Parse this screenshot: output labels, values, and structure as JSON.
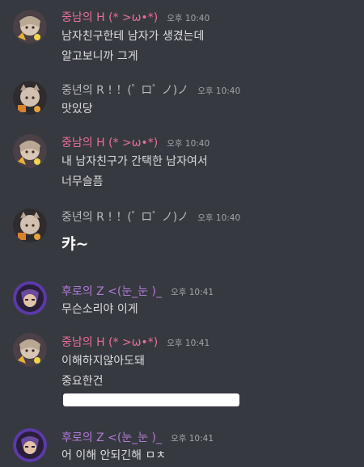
{
  "colors": {
    "background": "#36393f",
    "pink_user": "#e96e9e",
    "gray_user": "#b9bbbe",
    "purple_user": "#b27bd6"
  },
  "messages": [
    {
      "author": "중남의 H (* >ω•*)",
      "timestamp": "오후 10:40",
      "lines": [
        "남자친구한테 남자가 생겼는데",
        "알고보니까 그게"
      ]
    },
    {
      "author": "중년의 R ! ！(ﾟ ロﾟ ノ)ノ",
      "timestamp": "오후 10:40",
      "lines": [
        "맛있당"
      ]
    },
    {
      "author": "중남의 H (* >ω•*)",
      "timestamp": "오후 10:40",
      "lines": [
        "내 남자친구가 간택한 남자여서",
        "너무슬픔"
      ]
    },
    {
      "author": "중년의 R ! ！(ﾟ ロﾟ ノ)ノ",
      "timestamp": "오후 10:40",
      "lines": [
        "캬~"
      ]
    },
    {
      "author": "후로의 Z <(눈_눈 )_",
      "timestamp": "오후 10:41",
      "lines": [
        "무슨소리야 이게"
      ]
    },
    {
      "author": "중남의 H (* >ω•*)",
      "timestamp": "오후 10:41",
      "lines": [
        "이해하지않아도돼",
        "중요한건"
      ]
    },
    {
      "author": "후로의 Z <(눈_눈 )_",
      "timestamp": "오후 10:41",
      "lines": [
        "어 이해 안되긴해 ㅁㅊ"
      ]
    }
  ]
}
